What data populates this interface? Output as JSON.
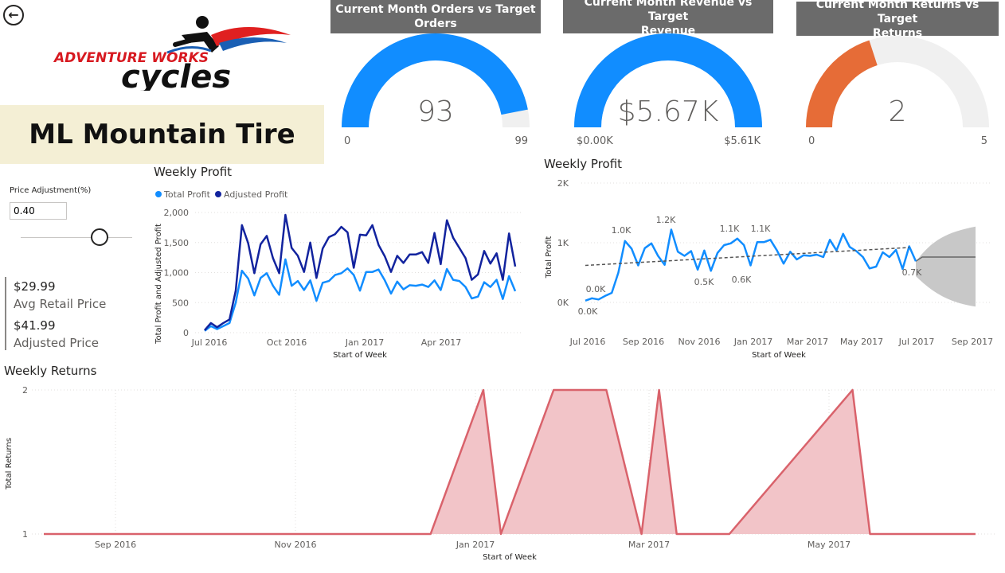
{
  "back": {
    "icon": "back-arrow-icon",
    "glyph": "←"
  },
  "logo": {
    "line1": "ADVENTURE WORKS",
    "line2": "cycles"
  },
  "product": {
    "name": "ML Mountain Tire"
  },
  "gauges": [
    {
      "title_l1": "Current Month Orders vs Target",
      "title_l2": "Orders",
      "value": "93",
      "min": "0",
      "max": "99",
      "min_num": 0,
      "max_num": 99,
      "value_num": 93,
      "color": "#118DFF"
    },
    {
      "title_l1": "Current Month Revenue vs Target",
      "title_l2": "Revenue",
      "value": "$5.67K",
      "min": "$0.00K",
      "max": "$5.61K",
      "min_num": 0,
      "max_num": 5.61,
      "value_num": 5.67,
      "color": "#118DFF"
    },
    {
      "title_l1": "Current Month Returns vs Target",
      "title_l2": "Returns",
      "value": "2",
      "min": "0",
      "max": "5",
      "min_num": 0,
      "max_num": 5,
      "value_num": 2,
      "color": "#E66C37"
    }
  ],
  "price_adjustment": {
    "label": "Price Adjustment(%)",
    "value": "0.40"
  },
  "cards": {
    "avg_retail_price": "$29.99",
    "avg_retail_label": "Avg Retail Price",
    "adjusted_price": "$41.99",
    "adjusted_label": "Adjusted Price"
  },
  "colors": {
    "total": "#118DFF",
    "adjusted": "#12239E",
    "returns_line": "#D9626B",
    "returns_fill": "#F2C4C8",
    "forecast": "#C8C8C8"
  },
  "chart_data": [
    {
      "type": "line",
      "title": "Weekly Profit",
      "xlabel": "Start of Week",
      "ylabel": "Total Profit and Adjusted Profit",
      "x_ticks": [
        "Jul 2016",
        "Oct 2016",
        "Jan 2017",
        "Apr 2017"
      ],
      "y_ticks": [
        "0",
        "500",
        "1,000",
        "1,500",
        "2,000"
      ],
      "ylim": [
        0,
        2000
      ],
      "legend": "top-left",
      "series": [
        {
          "name": "Total Profit",
          "values": [
            30,
            110,
            60,
            110,
            160,
            500,
            1030,
            900,
            620,
            910,
            990,
            780,
            630,
            1220,
            780,
            860,
            710,
            870,
            530,
            830,
            860,
            960,
            990,
            1070,
            960,
            700,
            1010,
            1010,
            1050,
            870,
            650,
            850,
            720,
            790,
            780,
            800,
            760,
            870,
            710,
            1060,
            880,
            860,
            760,
            570,
            600,
            840,
            760,
            880,
            560,
            940,
            690
          ]
        },
        {
          "name": "Adjusted Profit",
          "values": [
            40,
            160,
            90,
            160,
            220,
            700,
            1790,
            1490,
            990,
            1470,
            1610,
            1240,
            990,
            1960,
            1410,
            1280,
            1010,
            1500,
            910,
            1400,
            1590,
            1640,
            1760,
            1670,
            1080,
            1630,
            1620,
            1790,
            1460,
            1270,
            1010,
            1280,
            1160,
            1300,
            1300,
            1340,
            1160,
            1660,
            1140,
            1870,
            1580,
            1410,
            1240,
            880,
            970,
            1360,
            1150,
            1320,
            880,
            1650,
            1100
          ]
        }
      ]
    },
    {
      "type": "line",
      "title": "Weekly Profit",
      "xlabel": "Start of Week",
      "ylabel": "Total Profit",
      "x_ticks": [
        "Jul 2016",
        "Sep 2016",
        "Nov 2016",
        "Jan 2017",
        "Mar 2017",
        "May 2017",
        "Jul 2017",
        "Sep 2017"
      ],
      "y_ticks": [
        "0K",
        "1K",
        "2K"
      ],
      "ylim": [
        0,
        2000
      ],
      "series": [
        {
          "name": "Total Profit",
          "values": [
            30,
            70,
            50,
            110,
            160,
            500,
            1030,
            900,
            620,
            910,
            990,
            780,
            630,
            1220,
            850,
            780,
            860,
            550,
            870,
            530,
            830,
            960,
            990,
            1070,
            960,
            620,
            1010,
            1010,
            1050,
            870,
            650,
            850,
            720,
            790,
            780,
            800,
            760,
            1050,
            870,
            1150,
            930,
            860,
            760,
            570,
            600,
            840,
            760,
            880,
            560,
            940,
            690
          ]
        },
        {
          "name": "Trend",
          "values": [
            620,
            920
          ]
        },
        {
          "name": "Forecast",
          "values": [
            760,
            760,
            760,
            760,
            760,
            760,
            760,
            760,
            760
          ]
        }
      ],
      "data_labels": [
        "0.0K",
        "0.0K",
        "1.0K",
        "1.2K",
        "0.5K",
        "1.1K",
        "0.6K",
        "1.1K",
        "0.7K"
      ]
    },
    {
      "type": "area",
      "title": "Weekly Returns",
      "xlabel": "Start of Week",
      "ylabel": "Total Returns",
      "x_ticks": [
        "Sep 2016",
        "Nov 2016",
        "Jan 2017",
        "Mar 2017",
        "May 2017"
      ],
      "y_ticks": [
        "1",
        "2"
      ],
      "ylim": [
        1,
        2
      ],
      "series": [
        {
          "name": "Total Returns",
          "x": [
            "2016-07-04",
            "2016-12-05",
            "2016-12-26",
            "2017-01-02",
            "2017-01-23",
            "2017-02-13",
            "2017-02-27",
            "2017-03-06",
            "2017-03-13",
            "2017-04-03",
            "2017-05-22",
            "2017-05-29",
            "2017-07-10"
          ],
          "values": [
            1,
            1,
            2,
            1,
            2,
            2,
            1,
            2,
            1,
            1,
            2,
            1,
            1
          ]
        }
      ]
    }
  ],
  "labels": {
    "chart1_title": "Weekly Profit",
    "chart2_title": "Weekly Profit",
    "chart3_title": "Weekly Returns",
    "legend_total": "Total Profit",
    "legend_adjusted": "Adjusted Profit",
    "xlabel": "Start of Week",
    "ylabel1": "Total Profit and Adjusted Profit",
    "ylabel2": "Total Profit",
    "ylabel3": "Total Returns"
  }
}
